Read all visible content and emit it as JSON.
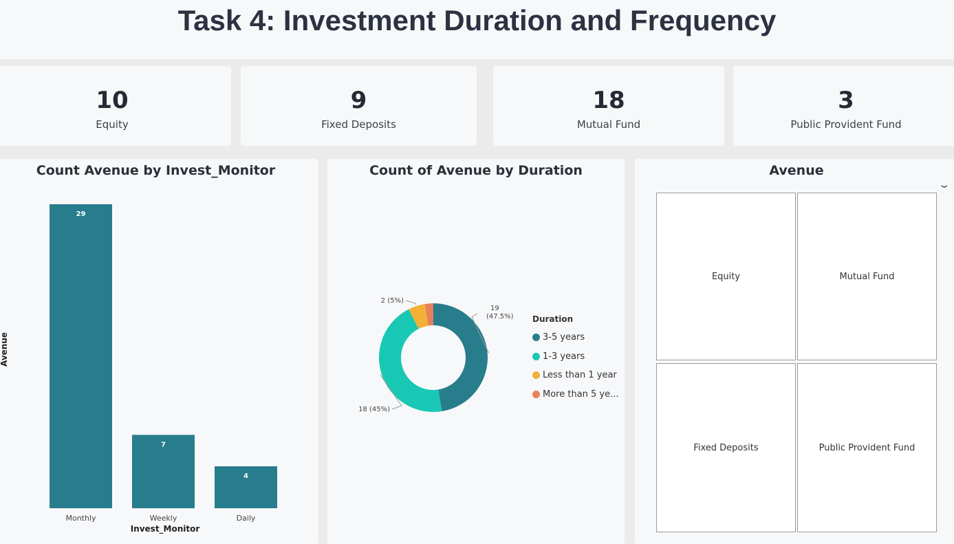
{
  "page": {
    "title": "Task 4: Investment Duration and Frequency"
  },
  "cards": [
    {
      "value": "10",
      "label": "Equity"
    },
    {
      "value": "9",
      "label": "Fixed Deposits"
    },
    {
      "value": "18",
      "label": "Mutual Fund"
    },
    {
      "value": "3",
      "label": "Public Provident Fund"
    }
  ],
  "bar_panel": {
    "title": "Count Avenue by Invest_Monitor"
  },
  "donut_panel": {
    "title": "Count of Avenue by Duration"
  },
  "slicer": {
    "title": "Avenue",
    "chevron_icon": "chevron-down-icon",
    "tiles": [
      "Equity",
      "Mutual Fund",
      "Fixed Deposits",
      "Public Provident Fund"
    ]
  },
  "colors": {
    "bar": "#287d8c",
    "series": [
      "#287d8c",
      "#19c8b4",
      "#f0b136",
      "#e8805c"
    ]
  },
  "chart_data": [
    {
      "type": "bar",
      "title": "Count Avenue by Invest_Monitor",
      "categories": [
        "Monthly",
        "Weekly",
        "Daily"
      ],
      "values": [
        29,
        7,
        4
      ],
      "xlabel": "Invest_Monitor",
      "ylabel": "Avenue",
      "ylim": [
        0,
        29
      ],
      "grid": false
    },
    {
      "type": "pie",
      "title": "Count of Avenue by Duration",
      "legend_title": "Duration",
      "legend_position": "right",
      "categories": [
        "3-5 years",
        "1-3 years",
        "Less than 1 year",
        "More than 5 ye..."
      ],
      "values": [
        19,
        18,
        2,
        1
      ],
      "labels": [
        "19 (47.5%)",
        "18 (45%)",
        "2 (5%)",
        ""
      ]
    }
  ]
}
